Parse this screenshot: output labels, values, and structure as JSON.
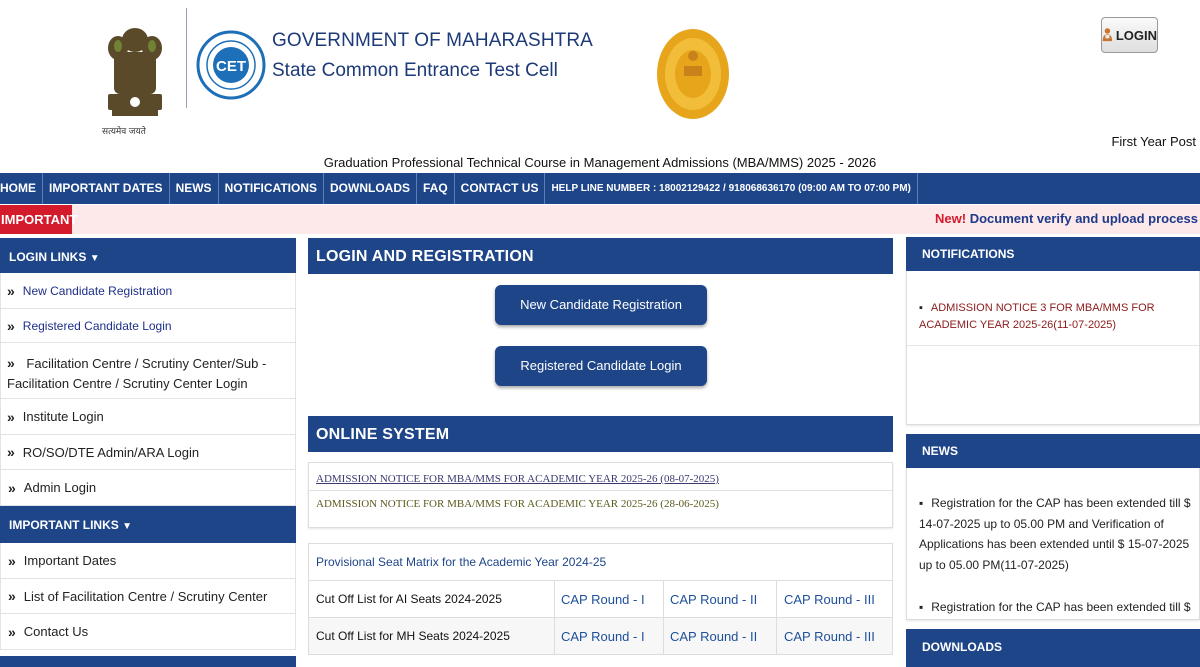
{
  "header": {
    "gov_title": "GOVERNMENT OF MAHARASHTRA",
    "gov_subtitle": "State Common Entrance Test Cell",
    "emblem_motto": "सत्यमेव जयते",
    "cet_logo_text": "CET",
    "login_label": "LOGIN",
    "first_year": "First Year Post",
    "course_title": "Graduation Professional Technical Course in Management Admissions (MBA/MMS) 2025 - 2026"
  },
  "nav": {
    "items": [
      "HOME",
      "IMPORTANT DATES",
      "NEWS",
      "NOTIFICATIONS",
      "DOWNLOADS",
      "FAQ",
      "CONTACT US"
    ],
    "helpline": "HELP LINE NUMBER : 18002129422 / 918068636170 (09:00 AM TO 07:00 PM)"
  },
  "important": {
    "label": "IMPORTANT",
    "new_tag": "New!",
    "message": "Document verify and upload process"
  },
  "login_links": {
    "title": "LOGIN LINKS",
    "items": [
      "New Candidate Registration",
      "Registered Candidate Login",
      "Facilitation Centre / Scrutiny Center/Sub - Facilitation Centre / Scrutiny Center Login",
      "Institute Login",
      "RO/SO/DTE Admin/ARA Login",
      "Admin Login"
    ]
  },
  "important_links": {
    "title": "IMPORTANT LINKS",
    "items": [
      "Important Dates",
      "List of Facilitation Centre / Scrutiny Center",
      "Contact Us"
    ]
  },
  "login_registration": {
    "title": "LOGIN AND REGISTRATION",
    "new_button": "New Candidate Registration",
    "login_button": "Registered Candidate Login"
  },
  "online_system": {
    "title": "ONLINE SYSTEM",
    "links": [
      "ADMISSION NOTICE FOR MBA/MMS FOR ACADEMIC YEAR 2025-26 (08-07-2025)",
      "ADMISSION NOTICE FOR MBA/MMS FOR ACADEMIC YEAR 2025-26 (28-06-2025)"
    ]
  },
  "seat_matrix": {
    "title": "Provisional Seat Matrix for the Academic Year 2024-25",
    "rows": [
      {
        "label": "Cut Off List for AI Seats 2024-2025",
        "rounds": [
          "CAP Round - I",
          "CAP Round - II",
          "CAP Round - III"
        ]
      },
      {
        "label": "Cut Off List for MH Seats 2024-2025",
        "rounds": [
          "CAP Round - I",
          "CAP Round - II",
          "CAP Round - III"
        ]
      }
    ]
  },
  "notifications": {
    "title": "NOTIFICATIONS",
    "items": [
      "ADMISSION NOTICE 3 FOR MBA/MMS FOR ACADEMIC YEAR 2025-26(11-07-2025)"
    ]
  },
  "news": {
    "title": "NEWS",
    "items": [
      "Registration for the CAP has been extended till $ 14-07-2025 up to 05.00 PM and Verification of Applications has been extended until $ 15-07-2025 up to 05.00 PM(11-07-2025)",
      "Registration for the CAP has been extended till $"
    ]
  },
  "downloads": {
    "title": "DOWNLOADS"
  },
  "colors": {
    "primary": "#1d4588",
    "important_red": "#d31b2c",
    "important_bg": "#fde8ea",
    "link_blue": "#1d2f8a",
    "notice_red": "#8b1a1a"
  }
}
